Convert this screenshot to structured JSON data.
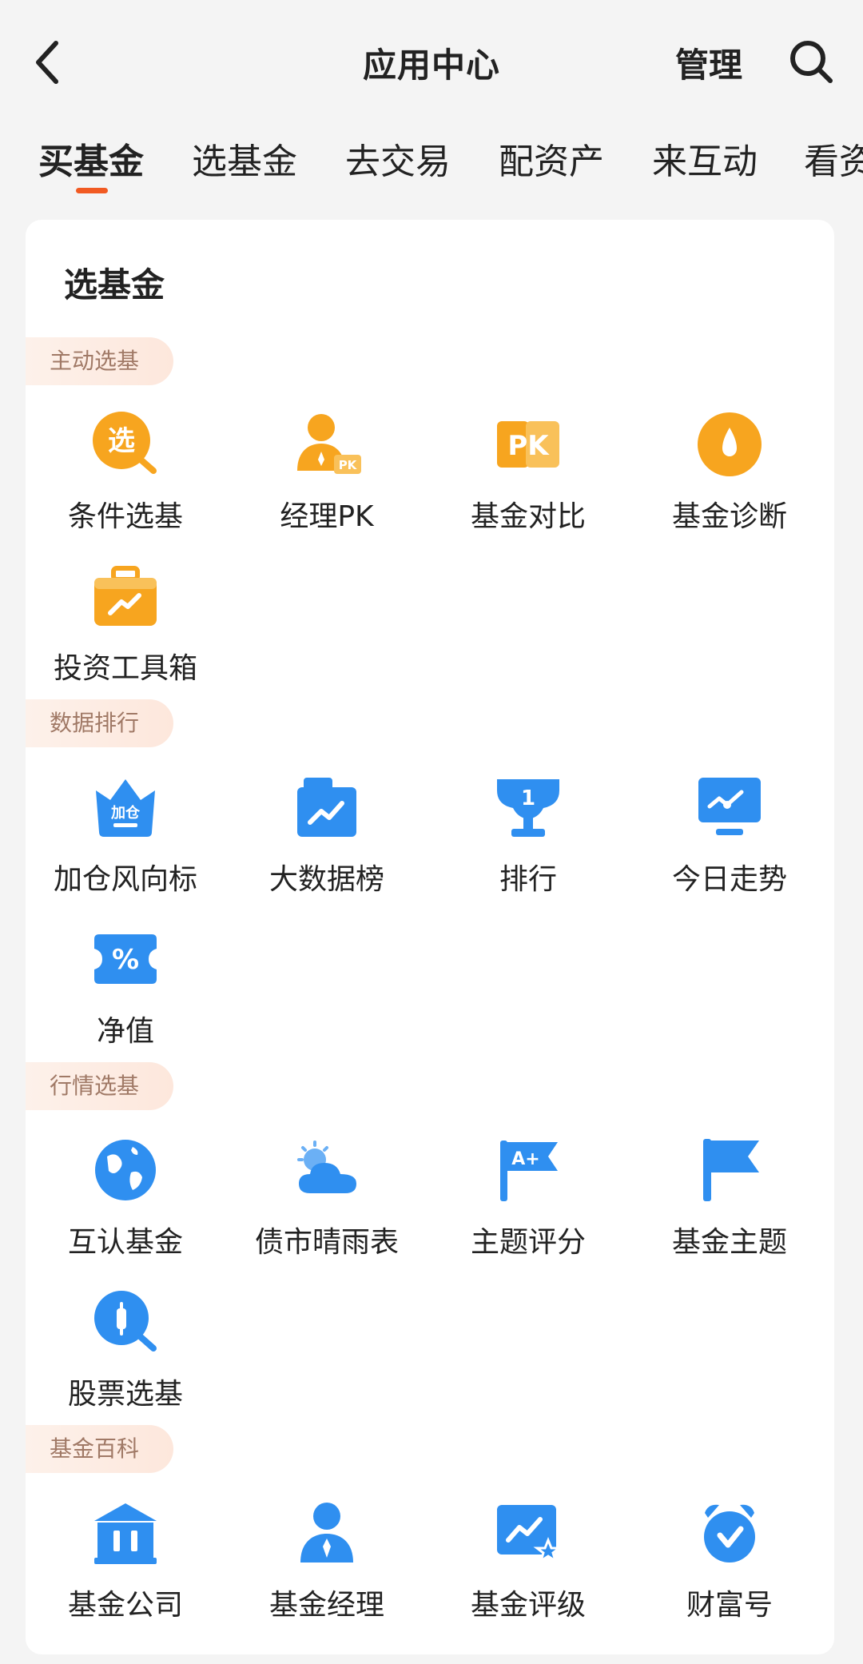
{
  "header": {
    "title": "应用中心",
    "manage_label": "管理"
  },
  "tabs": [
    {
      "label": "买基金",
      "active": true
    },
    {
      "label": "选基金"
    },
    {
      "label": "去交易"
    },
    {
      "label": "配资产"
    },
    {
      "label": "来互动"
    },
    {
      "label": "看资"
    }
  ],
  "card": {
    "title": "选基金"
  },
  "sections": [
    {
      "tag": "主动选基",
      "items": [
        {
          "label": "条件选基",
          "icon": "filter-search-icon",
          "icon_text": "选"
        },
        {
          "label": "经理PK",
          "icon": "manager-pk-icon",
          "icon_text": "PK"
        },
        {
          "label": "基金对比",
          "icon": "pk-compare-icon",
          "icon_text": "PK"
        },
        {
          "label": "基金诊断",
          "icon": "diagnosis-drop-icon"
        },
        {
          "label": "投资工具箱",
          "icon": "toolbox-icon"
        }
      ]
    },
    {
      "tag": "数据排行",
      "items": [
        {
          "label": "加仓风向标",
          "icon": "crown-add-icon",
          "icon_text": "加仓"
        },
        {
          "label": "大数据榜",
          "icon": "data-chart-icon"
        },
        {
          "label": "排行",
          "icon": "trophy-icon",
          "icon_text": "1"
        },
        {
          "label": "今日走势",
          "icon": "monitor-trend-icon"
        },
        {
          "label": "净值",
          "icon": "percent-coupon-icon",
          "icon_text": "%"
        }
      ]
    },
    {
      "tag": "行情选基",
      "items": [
        {
          "label": "互认基金",
          "icon": "globe-icon"
        },
        {
          "label": "债市晴雨表",
          "icon": "weather-cloud-icon"
        },
        {
          "label": "主题评分",
          "icon": "grade-flag-icon",
          "icon_text": "A+"
        },
        {
          "label": "基金主题",
          "icon": "flag-icon"
        },
        {
          "label": "股票选基",
          "icon": "stock-search-icon"
        }
      ]
    },
    {
      "tag": "基金百科",
      "items": [
        {
          "label": "基金公司",
          "icon": "bank-building-icon"
        },
        {
          "label": "基金经理",
          "icon": "manager-person-icon"
        },
        {
          "label": "基金评级",
          "icon": "rating-star-icon"
        },
        {
          "label": "财富号",
          "icon": "alarm-clock-icon"
        }
      ]
    }
  ],
  "colors": {
    "accent": "#f15a22",
    "orange_icon": "#f7a51f",
    "blue_icon": "#2f8ff0",
    "tag_bg": "#fde9df",
    "tag_text": "#a07966"
  }
}
